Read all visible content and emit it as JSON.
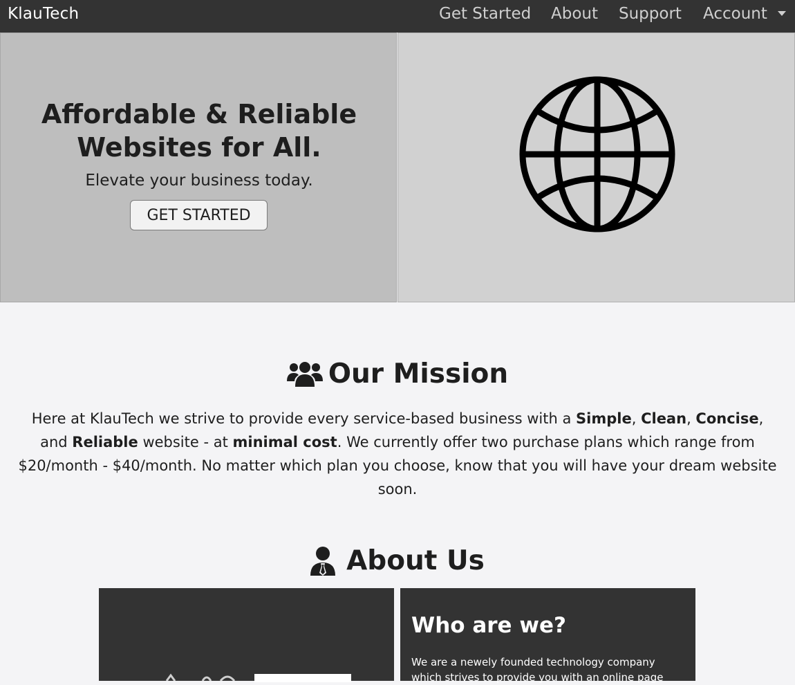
{
  "navbar": {
    "brand": "KlauTech",
    "links": [
      "Get Started",
      "About",
      "Support",
      "Account"
    ]
  },
  "hero": {
    "title_line1": "Affordable & Reliable",
    "title_line2": "Websites for All.",
    "subtitle": "Elevate your business today.",
    "cta_label": "GET STARTED",
    "image_icon": "globe-icon"
  },
  "mission": {
    "title": "Our Mission",
    "icon": "users-icon",
    "text_parts": [
      "Here at KlauTech we strive to provide every service-based business with a ",
      "Simple",
      ", ",
      "Clean",
      ", ",
      "Concise",
      ", and ",
      "Reliable",
      " website - at ",
      "minimal cost",
      ". We currently offer two purchase plans which range from $20/month - $40/month. No matter which plan you choose, know that you will have your dream website soon."
    ]
  },
  "about": {
    "title": "About Us",
    "icon": "user-tie-icon",
    "card_title": "Who are we?",
    "card_text": "We are a newely founded technology company which strives to provide you with an online page"
  },
  "colors": {
    "navbar_bg": "#333333",
    "hero_left_bg": "#bebebe",
    "hero_right_bg": "#d1d1d1",
    "page_bg": "#f4f4f6",
    "about_card_bg": "#333333"
  }
}
